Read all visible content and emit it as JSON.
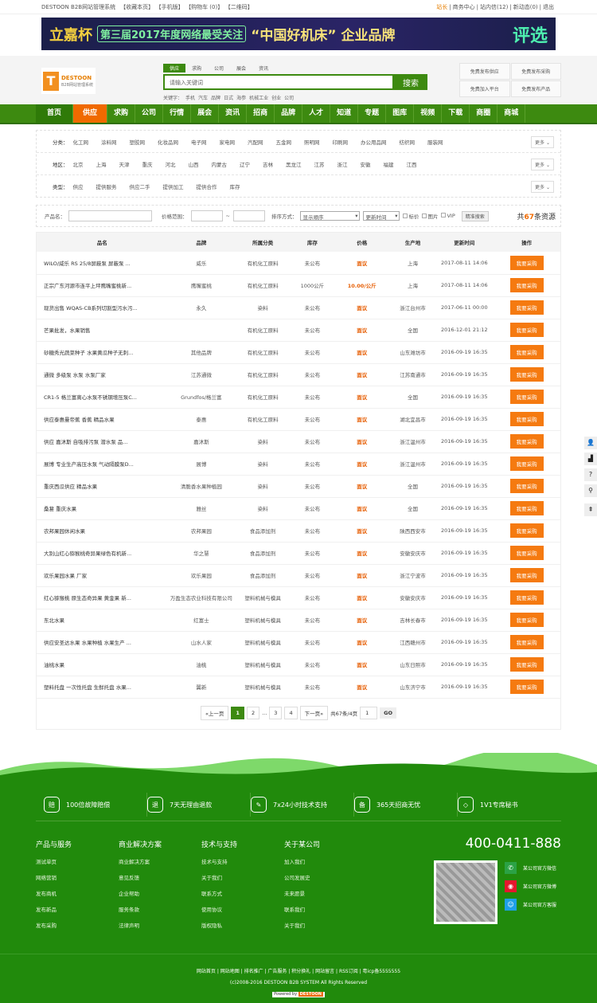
{
  "topbar": {
    "left": [
      "DESTOON B2B网站管理系统",
      "【收藏本页】",
      "【手机版】",
      "【购物车 (0)】",
      "【二维码】"
    ],
    "right": [
      "站长",
      "商务中心",
      "站内信(12)",
      "新动态(0)",
      "退出"
    ]
  },
  "banner": {
    "brand": "立嘉杯",
    "edition": "第三届2017年度网络最受关注",
    "title": "“中国好机床” 企业品牌",
    "badge": "评选"
  },
  "logo": {
    "name": "DESTOON",
    "subtitle": "B2B网站管理系统"
  },
  "search": {
    "tabs": [
      "供应",
      "求购",
      "公司",
      "展会",
      "资讯"
    ],
    "placeholder": "请输入关键词",
    "button": "搜索",
    "keywords_label": "关键字：",
    "keywords": [
      "手机",
      "汽车",
      "品牌",
      "日式",
      "海参",
      "机械工业",
      "创业",
      "公司"
    ]
  },
  "publish": [
    "免费发布供应",
    "免费发布采购",
    "免费加入平台",
    "免费发布产品"
  ],
  "nav": [
    "首页",
    "供应",
    "求购",
    "公司",
    "行情",
    "展会",
    "资讯",
    "招商",
    "品牌",
    "人才",
    "知道",
    "专题",
    "图库",
    "视频",
    "下载",
    "商圈",
    "商城"
  ],
  "filters": [
    {
      "label": "分类：",
      "options": [
        "化工网",
        "涂料网",
        "塑胶网",
        "化妆品网",
        "电子网",
        "家电网",
        "汽配网",
        "五金网",
        "照明网",
        "印刷网",
        "办公用品网",
        "纺织网",
        "服装网"
      ]
    },
    {
      "label": "地区：",
      "options": [
        "北京",
        "上海",
        "天津",
        "重庆",
        "河北",
        "山西",
        "内蒙古",
        "辽宁",
        "吉林",
        "黑龙江",
        "江苏",
        "浙江",
        "安徽",
        "福建",
        "江西"
      ]
    },
    {
      "label": "类型：",
      "options": [
        "供应",
        "提供服务",
        "供应二手",
        "提供加工",
        "提供合作",
        "库存"
      ]
    }
  ],
  "more_label": "更多",
  "searchbar": {
    "product_label": "产品名：",
    "price_label": "价格范围：",
    "tilde": "~",
    "sort_label": "排序方式：",
    "sort_value": "显示顺序",
    "order_value": "更新时间",
    "checks": [
      "标价",
      "图片",
      "VIP"
    ],
    "button": "精准搜索",
    "total_pre": "共",
    "total": "67",
    "total_post": "条资源"
  },
  "table": {
    "headers": [
      "品名",
      "品牌",
      "所属分类",
      "库存",
      "价格",
      "生产地",
      "更新时间",
      "操作"
    ],
    "action": "我要采购",
    "rows": [
      [
        "WILO/威乐 RS 25/8屏蔽泵 屏蔽泵 ...",
        "威乐",
        "有机化工原料",
        "未公布",
        "面议",
        "上海",
        "2017-08-11 14:06"
      ],
      [
        "正宗广东河源市连平上坪鹰嘴蜜桃新...",
        "鹰嘴蜜桃",
        "有机化工原料",
        "1000公斤",
        "10.00/公斤",
        "上海",
        "2017-08-11 14:06"
      ],
      [
        "现货出售 WQAS-CB系列切割型污水污...",
        "永久",
        "染料",
        "未公布",
        "面议",
        "浙江台州市",
        "2017-06-11 00:00"
      ],
      [
        "芒果批发，水果销售",
        "",
        "有机化工原料",
        "未公布",
        "面议",
        "全国",
        "2016-12-01 21:12"
      ],
      [
        "砂糖秀光蔬菜种子 水果黄瓜种子无刺...",
        "其他品牌",
        "有机化工原料",
        "未公布",
        "面议",
        "山东潍坊市",
        "2016-09-19 16:35"
      ],
      [
        "通微 多级泵 水泵 水泵厂家",
        "江苏通微",
        "有机化工原料",
        "未公布",
        "面议",
        "江苏南通市",
        "2016-09-19 16:35"
      ],
      [
        "CR1-5 格兰富离心水泵不锈钢增压泵C...",
        "Grundfos/格兰富",
        "有机化工原料",
        "未公布",
        "面议",
        "全国",
        "2016-09-19 16:35"
      ],
      [
        "供应泰惠曼帝蕉 香蕉 精品水果",
        "泰惠",
        "有机化工原料",
        "未公布",
        "面议",
        "湖北宜昌市",
        "2016-09-19 16:35"
      ],
      [
        "供应 嘉沐斯 自吸排污泵 潜水泵 品...",
        "嘉沐斯",
        "染料",
        "未公布",
        "面议",
        "浙江温州市",
        "2016-09-19 16:35"
      ],
      [
        "展博 专业生产高压水泵 气动隔膜泵D...",
        "展博",
        "染料",
        "未公布",
        "面议",
        "浙江温州市",
        "2016-09-19 16:35"
      ],
      [
        "重庆西瓜供应 精品水果",
        "清脆香水果种植园",
        "染料",
        "未公布",
        "面议",
        "全国",
        "2016-09-19 16:35"
      ],
      [
        "桑葚 重庆水果",
        "雅丝",
        "染料",
        "未公布",
        "面议",
        "全国",
        "2016-09-19 16:35"
      ],
      [
        "农邦果园休闲水果",
        "农邦果园",
        "食品添加剂",
        "未公布",
        "面议",
        "陕西西安市",
        "2016-09-19 16:35"
      ],
      [
        "大别山红心猕猴桃奇异果绿色有机新...",
        "华之慧",
        "食品添加剂",
        "未公布",
        "面议",
        "安徽安庆市",
        "2016-09-19 16:35"
      ],
      [
        "欢乐果园水果 厂家",
        "欢乐果园",
        "食品添加剂",
        "未公布",
        "面议",
        "浙江宁波市",
        "2016-09-19 16:35"
      ],
      [
        "红心猕猴桃 原生态奇异果 黄金果 新...",
        "万盈生态农业科技有限公司",
        "塑料机械与模具",
        "未公布",
        "面议",
        "安徽安庆市",
        "2016-09-19 16:35"
      ],
      [
        "东北水果",
        "红富士",
        "塑料机械与模具",
        "未公布",
        "面议",
        "吉林长春市",
        "2016-09-19 16:35"
      ],
      [
        "供应安圣达水果 水果种植 水果生产 ...",
        "山水人家",
        "塑料机械与模具",
        "未公布",
        "面议",
        "江西赣州市",
        "2016-09-19 16:35"
      ],
      [
        "油桃水果",
        "油桃",
        "塑料机械与模具",
        "未公布",
        "面议",
        "山东日照市",
        "2016-09-19 16:35"
      ],
      [
        "塑料托盘 一次性托盘 生鲜托盘 水果...",
        "翼新",
        "塑料机械与模具",
        "未公布",
        "面议",
        "山东济宁市",
        "2016-09-19 16:35"
      ]
    ]
  },
  "pager": {
    "prev": "«上一页",
    "pages": [
      "1",
      "2",
      "...",
      "3",
      "4"
    ],
    "next": "下一页»",
    "info": "共67条/4页",
    "input": "1",
    "go": "GO"
  },
  "features": [
    {
      "icon": "赔",
      "text": "100倍故障赔偿"
    },
    {
      "icon": "退",
      "text": "7天无理由退款"
    },
    {
      "icon": "✎",
      "text": "7x24小时技术支持"
    },
    {
      "icon": "备",
      "text": "365天招商无忧"
    },
    {
      "icon": "◇",
      "text": "1V1专席秘书"
    }
  ],
  "footer_cols": [
    {
      "title": "产品与服务",
      "links": [
        "测试单页",
        "网络营销",
        "发布商机",
        "发布新品",
        "发布采购"
      ]
    },
    {
      "title": "商业解决方案",
      "links": [
        "商业解决方案",
        "意见反馈",
        "企业帮助",
        "服务条款",
        "法律声明"
      ]
    },
    {
      "title": "技术与支持",
      "links": [
        "技术与支持",
        "关于我们",
        "联系方式",
        "使用协议",
        "版权隐私"
      ]
    },
    {
      "title": "关于某公司",
      "links": [
        "加入我们",
        "公司发展史",
        "未来愿景",
        "联系我们",
        "关于我们"
      ]
    }
  ],
  "phone": "400-0411-888",
  "social": [
    "某公司官方微信",
    "某公司官方微博",
    "某公司官方客服"
  ],
  "bottom_links": "网站首页 | 网站地图 | 排名推广 | 广告服务 | 积分换礼 | 网站留言 | RSS订阅 | 粤icp备5555555",
  "copyright": "(c)2008-2016 DESTOON B2B SYSTEM All Rights Reserved",
  "powered": "Powered by",
  "powered_brand": "DESTOON",
  "colors": {
    "green": "#3d8a10",
    "orange": "#f06a00",
    "footer": "#218a0c"
  }
}
